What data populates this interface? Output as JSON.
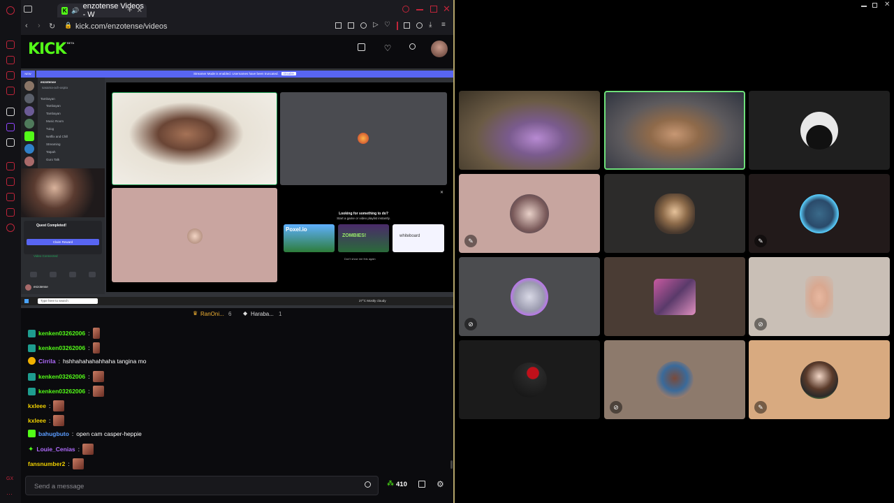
{
  "browser": {
    "tab_title": "enzotense Videos - W",
    "url": "kick.com/enzotense/videos"
  },
  "kick": {
    "logo": "KICK",
    "beta": "BETA"
  },
  "discord": {
    "banner": "Streamer Mode is enabled. Usernames have been truncated.",
    "banner_button": "Disable",
    "server_name": "enzotense",
    "sub_name": "sasama-ach-aspta",
    "category": "Tambayan",
    "channels": [
      "Tambayan",
      "Tambayan",
      "Music Room",
      "Tulog",
      "Netflix and Chill",
      "Streaming",
      "Tatpah",
      "Guro Talk"
    ],
    "quest_title": "Quest Completed!",
    "quest_button": "Claim Reward",
    "voice_status": "Video Connected",
    "user_name": "enzotense",
    "suggest_title": "Looking for something to do?",
    "suggest_sub": "Start a game or video playlist instantly.",
    "activities": [
      "Poxel.io",
      "ZOMBIES!",
      "whiteboard"
    ],
    "dont_show": "Don't show me this again",
    "search_placeholder": "Type here to search",
    "weather": "27°C Mostly cloudy"
  },
  "share_bar": {
    "user1": "RanOni...",
    "user1_count": "6",
    "user2": "Haraba...",
    "user2_count": "1"
  },
  "chat": {
    "messages": [
      {
        "user": "kenken03262006",
        "text": "",
        "color": "#53fc18"
      },
      {
        "user": "kenken03262006",
        "text": "",
        "color": "#53fc18"
      },
      {
        "user": "Cirrila",
        "text": "hshhahahahahhaha tangina mo",
        "color": "#b16cff"
      },
      {
        "user": "kenken03262006",
        "text": "",
        "color": "#53fc18"
      },
      {
        "user": "kenken03262006",
        "text": "",
        "color": "#53fc18"
      },
      {
        "user": "kxleee",
        "text": "",
        "color": "#f0d000"
      },
      {
        "user": "kxleee",
        "text": "",
        "color": "#f0d000"
      },
      {
        "user": "bahugbuto",
        "text": "open cam casper-heppie",
        "color": "#5a9cff"
      },
      {
        "user": "Louie_Cenias",
        "text": "",
        "color": "#b16cff"
      },
      {
        "user": "fansnumber2",
        "text": "",
        "color": "#f0d000"
      }
    ],
    "input_placeholder": "Send a message",
    "points": "410"
  },
  "colors": {
    "kick_green": "#53fc18",
    "discord_blurple": "#5865f2",
    "opera_red": "#c0253a"
  }
}
